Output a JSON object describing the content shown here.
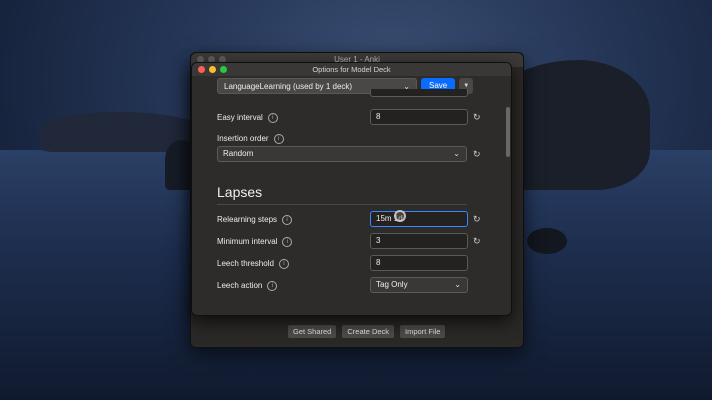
{
  "main_window": {
    "title": "User 1 - Anki",
    "buttons": [
      "Get Shared",
      "Create Deck",
      "Import File"
    ]
  },
  "options_window": {
    "title": "Options for Model Deck",
    "deck_select": "LanguageLearning (used by 1 deck)",
    "save_label": "Save",
    "easy_interval": {
      "label": "Easy interval",
      "value": "8"
    },
    "insertion_order": {
      "label": "Insertion order",
      "value": "Random"
    },
    "lapses_heading": "Lapses",
    "relearning_steps": {
      "label": "Relearning steps",
      "value": "15m 1d"
    },
    "minimum_interval": {
      "label": "Minimum interval",
      "value": "3"
    },
    "leech_threshold": {
      "label": "Leech threshold",
      "value": "8"
    },
    "leech_action": {
      "label": "Leech action",
      "value": "Tag Only"
    }
  },
  "colors": {
    "accent": "#0a6bff"
  }
}
